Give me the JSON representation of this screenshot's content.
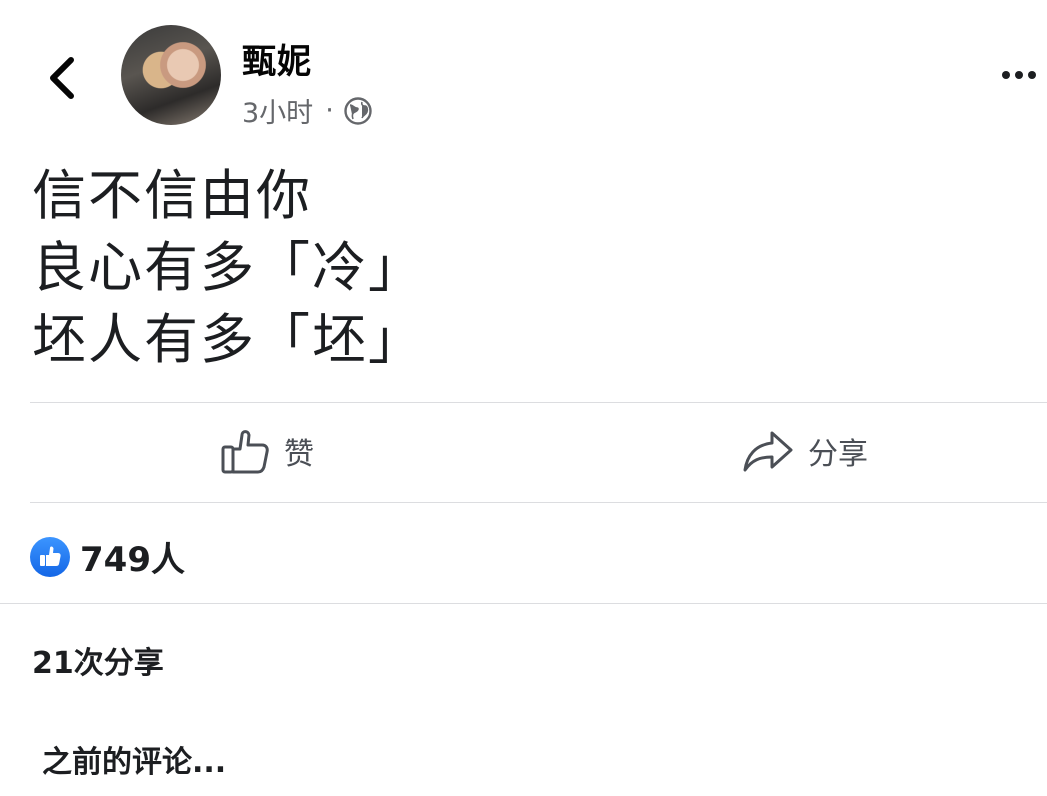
{
  "post": {
    "author": "甄妮",
    "time": "3小时",
    "separator": "·",
    "audience_icon": "globe-icon",
    "lines": [
      "信不信由你",
      "良心有多「冷」",
      "坯人有多「坯」"
    ]
  },
  "actions": {
    "like_label": "赞",
    "share_label": "分享"
  },
  "stats": {
    "reaction_count": "749人",
    "share_count": "21次分享"
  },
  "comments": {
    "previous_label": "之前的评论..."
  },
  "icons": {
    "back": "chevron-left-icon",
    "more": "more-horizontal-icon",
    "like": "thumbs-up-icon",
    "share": "share-arrow-icon",
    "reaction": "like-reaction-icon"
  },
  "colors": {
    "text_primary": "#1c1e21",
    "text_secondary": "#65676b",
    "divider": "#dcdde0",
    "like_blue": "#1877f2"
  }
}
